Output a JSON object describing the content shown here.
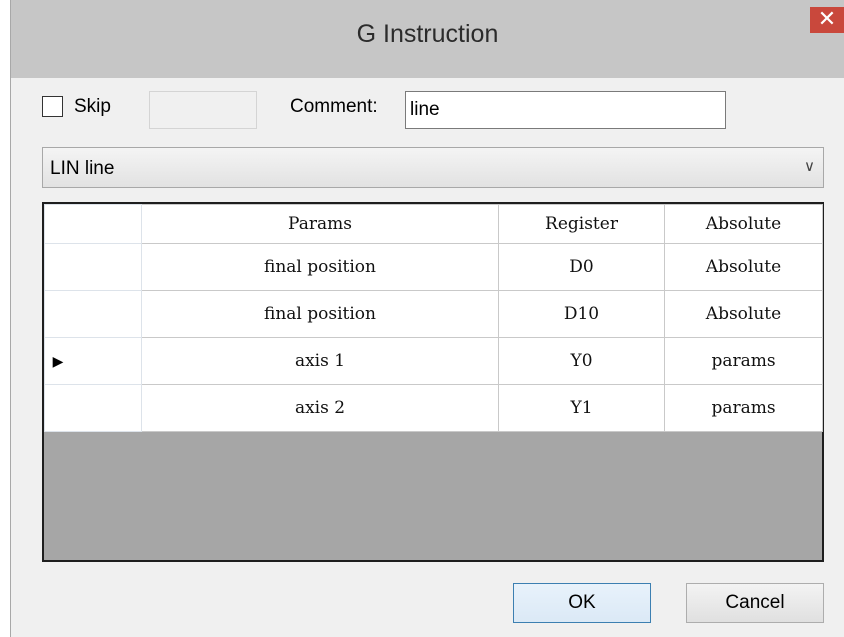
{
  "window": {
    "title": "G Instruction",
    "close_glyph": "✕"
  },
  "skip": {
    "label": "Skip",
    "checked": false,
    "field_value": ""
  },
  "comment": {
    "label": "Comment:",
    "value": "line"
  },
  "instruction_select": {
    "selected": "LIN line",
    "arrow_icon": "chevron-down-icon"
  },
  "grid": {
    "columns": [
      "",
      "Params",
      "Register",
      "Absolute"
    ],
    "rows": [
      {
        "indicator": "",
        "params": "final position",
        "register": "D0",
        "absolute": "Absolute"
      },
      {
        "indicator": "",
        "params": "final position",
        "register": "D10",
        "absolute": "Absolute"
      },
      {
        "indicator": "▶",
        "params": "axis 1",
        "register": "Y0",
        "absolute": "params"
      },
      {
        "indicator": "",
        "params": "axis 2",
        "register": "Y1",
        "absolute": "params"
      }
    ]
  },
  "buttons": {
    "ok": "OK",
    "cancel": "Cancel"
  }
}
